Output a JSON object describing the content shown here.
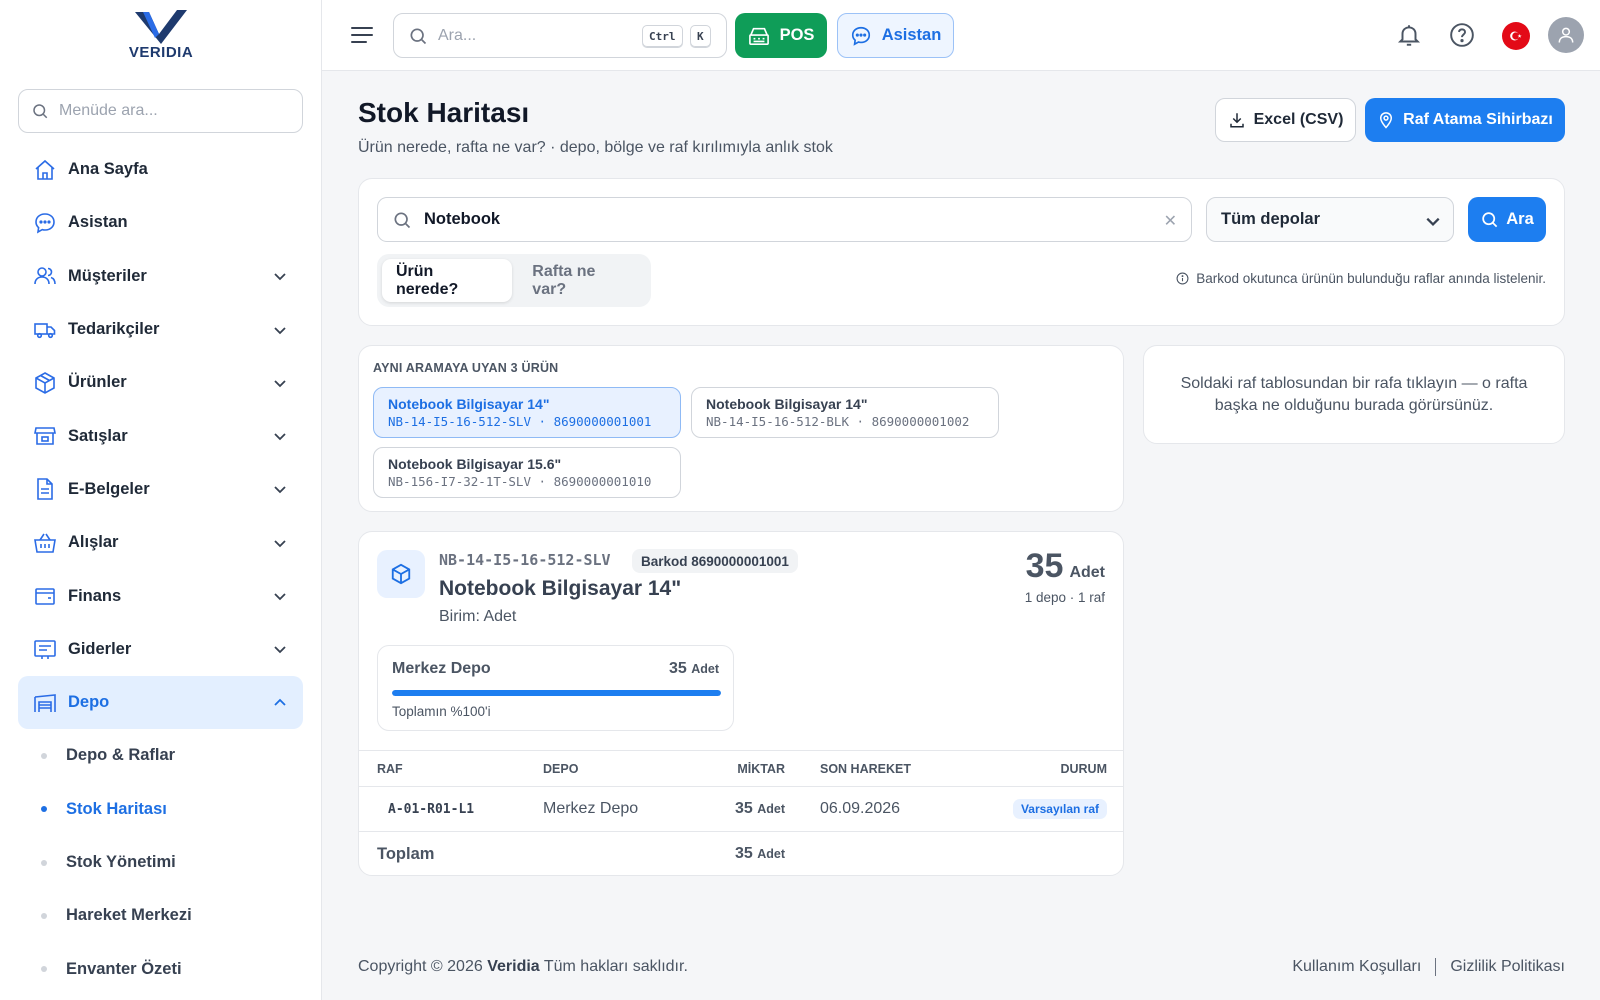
{
  "brand": {
    "name": "VERIDIA"
  },
  "sidebar": {
    "search_placeholder": "Menüde ara...",
    "items": [
      {
        "label": "Ana Sayfa",
        "icon": "home-icon"
      },
      {
        "label": "Asistan",
        "icon": "chat-icon"
      },
      {
        "label": "Müşteriler",
        "icon": "users-icon"
      },
      {
        "label": "Tedarikçiler",
        "icon": "truck-icon"
      },
      {
        "label": "Ürünler",
        "icon": "box-icon"
      },
      {
        "label": "Satışlar",
        "icon": "store-icon"
      },
      {
        "label": "E-Belgeler",
        "icon": "document-icon"
      },
      {
        "label": "Alışlar",
        "icon": "basket-icon"
      },
      {
        "label": "Finans",
        "icon": "wallet-icon"
      },
      {
        "label": "Giderler",
        "icon": "receipt-icon"
      },
      {
        "label": "Depo",
        "icon": "warehouse-icon"
      }
    ],
    "sub_items": [
      {
        "label": "Depo & Raflar"
      },
      {
        "label": "Stok Haritası"
      },
      {
        "label": "Stok Yönetimi"
      },
      {
        "label": "Hareket Merkezi"
      },
      {
        "label": "Envanter Özeti"
      }
    ]
  },
  "topbar": {
    "search_placeholder": "Ara...",
    "kbd_ctrl": "Ctrl",
    "kbd_k": "K",
    "pos_label": "POS",
    "assistant_label": "Asistan"
  },
  "page": {
    "title": "Stok Haritası",
    "subtitle": "Ürün nerede, rafta ne var? · depo, bölge ve raf kırılımıyla anlık stok",
    "excel_label": "Excel (CSV)",
    "wizard_label": "Raf Atama Sihirbazı"
  },
  "search": {
    "value": "Notebook",
    "depot_selected": "Tüm depolar",
    "search_button": "Ara",
    "tabs": [
      "Ürün nerede?",
      "Rafta ne var?"
    ],
    "hint": "Barkod okutunca ürünün bulunduğu raflar anında listelenir."
  },
  "matches": {
    "title": "AYNI ARAMAYA UYAN 3 ÜRÜN",
    "items": [
      {
        "name": "Notebook Bilgisayar 14\"",
        "code": "NB-14-I5-16-512-SLV · 8690000001001"
      },
      {
        "name": "Notebook Bilgisayar 14\"",
        "code": "NB-14-I5-16-512-BLK · 8690000001002"
      },
      {
        "name": "Notebook Bilgisayar 15.6\"",
        "code": "NB-156-I7-32-1T-SLV · 8690000001010"
      }
    ]
  },
  "info_text": "Soldaki raf tablosundan bir rafa tıklayın — o rafta başka ne olduğunu burada görürsünüz.",
  "product": {
    "sku": "NB-14-I5-16-512-SLV",
    "barcode": "Barkod 8690000001001",
    "name": "Notebook Bilgisayar 14\"",
    "unit": "Birim: Adet",
    "total_qty": "35",
    "qty_unit": "Adet",
    "meta": "1 depo · 1 raf",
    "depot": {
      "name": "Merkez Depo",
      "qty": "35",
      "unit": "Adet",
      "share_pct": 100,
      "share_label": "Toplamın %100'i"
    }
  },
  "table": {
    "headers": [
      "RAF",
      "DEPO",
      "MİKTAR",
      "SON HAREKET",
      "DURUM"
    ],
    "rows": [
      {
        "raf": "A-01-R01-L1",
        "depo": "Merkez Depo",
        "qty": "35",
        "unit": "Adet",
        "date": "06.09.2026",
        "status": "Varsayılan raf"
      }
    ],
    "total_label": "Toplam",
    "total_qty": "35",
    "total_unit": "Adet"
  },
  "footer": {
    "copyright_prefix": "Copyright © 2026",
    "brand": "Veridia",
    "copyright_suffix": "Tüm hakları saklıdır.",
    "links": [
      "Kullanım Koşulları",
      "Gizlilik Politikası"
    ]
  },
  "colors": {
    "accent": "#1d7ef0",
    "pos": "#0f9d58",
    "active_bg": "#e3efff"
  }
}
